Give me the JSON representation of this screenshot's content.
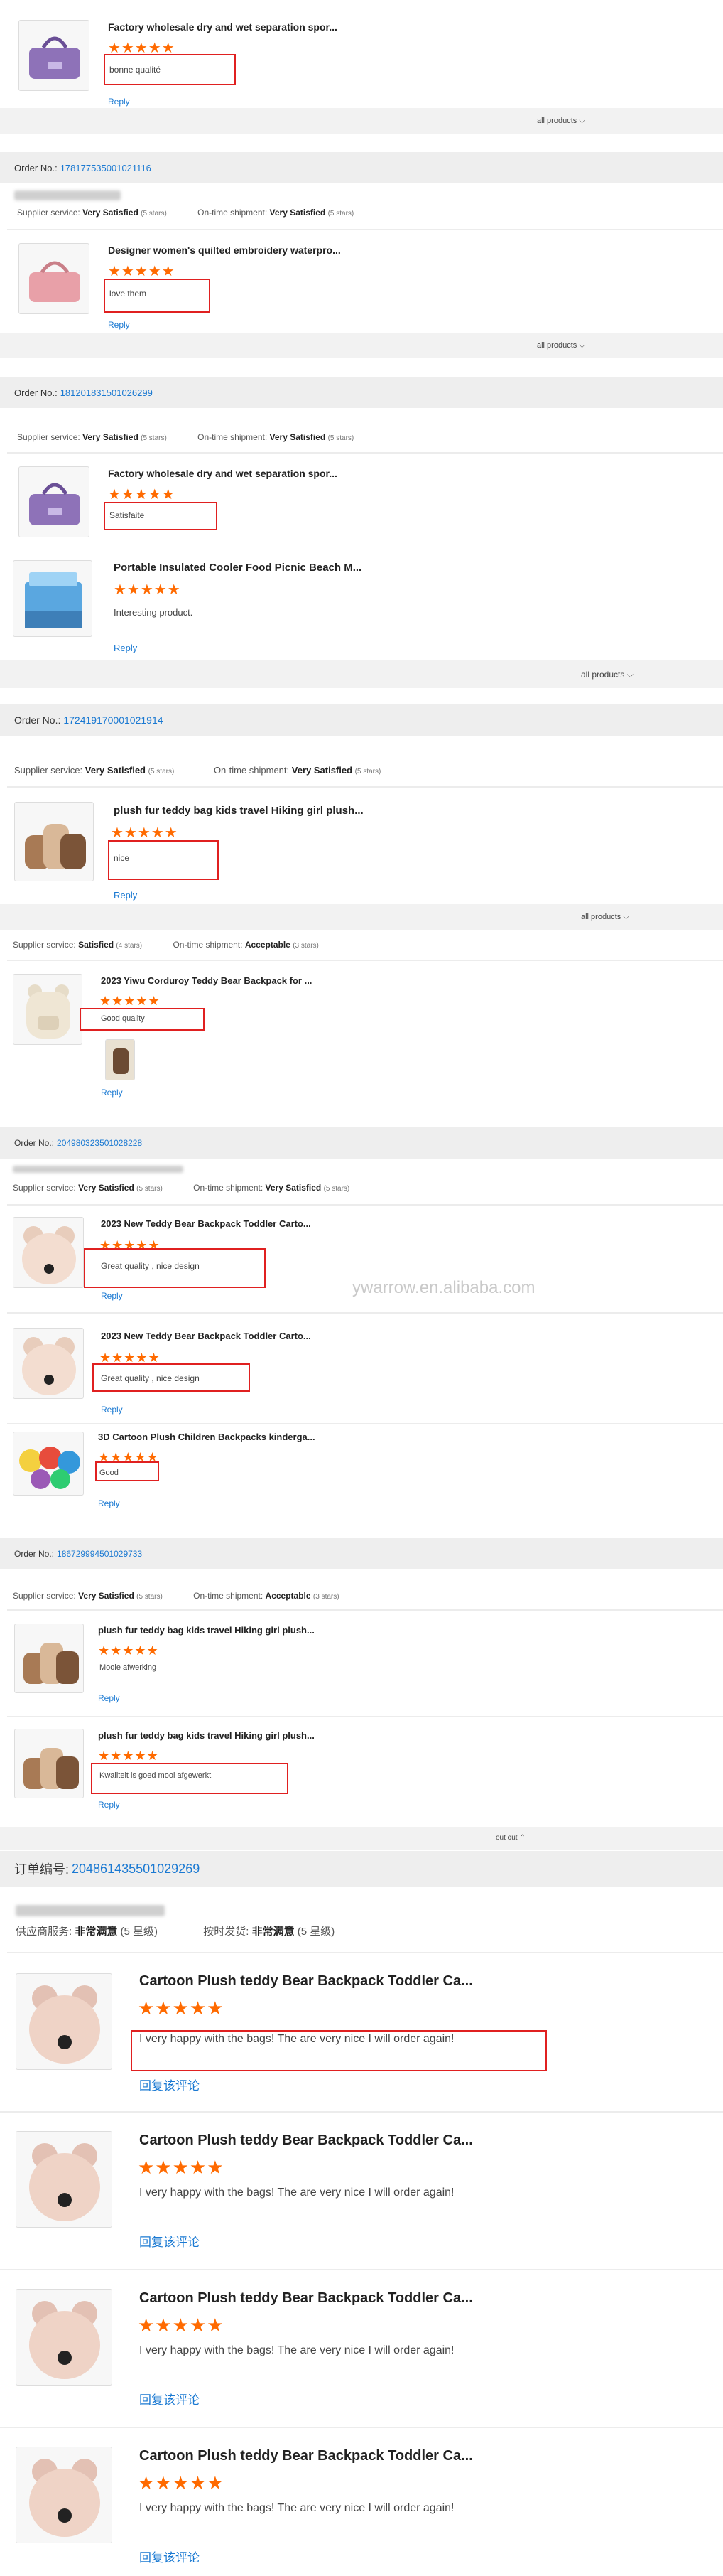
{
  "footer_labels": {
    "all_products": "all products",
    "out_out": "out out",
    "reply": "Reply",
    "reply_cn": "回复该评论"
  },
  "watermark": "ywarrow.en.alibaba.com",
  "order_label": "Order No.:",
  "order_label_cn": "订单编号:",
  "orders": [
    {
      "order_no": "178177535001021116",
      "supplier_service": "Supplier service:",
      "supplier_rating": "Very Satisfied",
      "supplier_stars": "(5 stars)",
      "shipment_label": "On-time shipment:",
      "shipment_rating": "Very Satisfied",
      "shipment_stars": "(5 stars)"
    },
    {
      "order_no": "181201831501026299",
      "supplier_service": "Supplier service:",
      "supplier_rating": "Very Satisfied",
      "supplier_stars": "(5 stars)",
      "shipment_label": "On-time shipment:",
      "shipment_rating": "Very Satisfied",
      "shipment_stars": "(5 stars)"
    },
    {
      "order_no": "172419170001021914",
      "supplier_service": "Supplier service:",
      "supplier_rating": "Very Satisfied",
      "supplier_stars": "(5 stars)",
      "shipment_label": "On-time shipment:",
      "shipment_rating": "Very Satisfied",
      "shipment_stars": "(5 stars)"
    },
    {
      "order_no": "",
      "supplier_service": "Supplier service:",
      "supplier_rating": "Satisfied",
      "supplier_stars": "(4 stars)",
      "shipment_label": "On-time shipment:",
      "shipment_rating": "Acceptable",
      "shipment_stars": "(3 stars)"
    },
    {
      "order_no": "204980323501028228",
      "supplier_service": "Supplier service:",
      "supplier_rating": "Very Satisfied",
      "supplier_stars": "(5 stars)",
      "shipment_label": "On-time shipment:",
      "shipment_rating": "Very Satisfied",
      "shipment_stars": "(5 stars)"
    },
    {
      "order_no": "186729994501029733",
      "supplier_service": "Supplier service:",
      "supplier_rating": "Very Satisfied",
      "supplier_stars": "(5 stars)",
      "shipment_label": "On-time shipment:",
      "shipment_rating": "Acceptable",
      "shipment_stars": "(3 stars)"
    },
    {
      "order_no": "204861435501029269",
      "supplier_service": "供应商服务:",
      "supplier_rating": "非常满意",
      "supplier_stars": "(5 星级)",
      "shipment_label": "按时发货:",
      "shipment_rating": "非常满意",
      "shipment_stars": "(5 星级)"
    }
  ],
  "reviews": [
    {
      "title": "Factory wholesale dry and wet separation spor...",
      "comment": "bonne qualité",
      "rating": 5
    },
    {
      "title": "Designer women's quilted embroidery waterpro...",
      "comment": "love them",
      "rating": 5
    },
    {
      "title": "Factory wholesale dry and wet separation spor...",
      "comment": "Satisfaite",
      "rating": 5
    },
    {
      "title": "Portable Insulated Cooler Food Picnic Beach M...",
      "comment": "Interesting product.",
      "rating": 5
    },
    {
      "title": "plush fur teddy bag kids travel Hiking girl plush...",
      "comment": "nice",
      "rating": 5
    },
    {
      "title": "2023 Yiwu Corduroy Teddy Bear Backpack for ...",
      "comment": "Good quality",
      "rating": 5
    },
    {
      "title": "2023 New Teddy Bear Backpack Toddler Carto...",
      "comment": "Great quality , nice design",
      "rating": 5
    },
    {
      "title": "2023 New Teddy Bear Backpack Toddler Carto...",
      "comment": "Great quality , nice design",
      "rating": 5
    },
    {
      "title": "3D Cartoon Plush Children Backpacks kinderga...",
      "comment": "Good",
      "rating": 5
    },
    {
      "title": "plush fur teddy bag kids travel Hiking girl plush...",
      "comment": "Mooie afwerking",
      "rating": 5
    },
    {
      "title": "plush fur teddy bag kids travel Hiking girl plush...",
      "comment": "Kwaliteit is goed mooi afgewerkt",
      "rating": 5
    },
    {
      "title": "Cartoon Plush teddy Bear Backpack Toddler Ca...",
      "comment": "I very happy with the bags! The are very nice I will order again!",
      "rating": 5
    },
    {
      "title": "Cartoon Plush teddy Bear Backpack Toddler Ca...",
      "comment": "I very happy with the bags! The are very nice I will order again!",
      "rating": 5
    },
    {
      "title": "Cartoon Plush teddy Bear Backpack Toddler Ca...",
      "comment": "I very happy with the bags! The are very nice I will order again!",
      "rating": 5
    },
    {
      "title": "Cartoon Plush teddy Bear Backpack Toddler Ca...",
      "comment": "I very happy with the bags! The are very nice I will order again!",
      "rating": 5
    }
  ],
  "colors": {
    "accent_orange": "#ff6a00",
    "link_blue": "#1a79d2",
    "highlight_red": "#e02020",
    "header_gray": "#eeeeee"
  }
}
